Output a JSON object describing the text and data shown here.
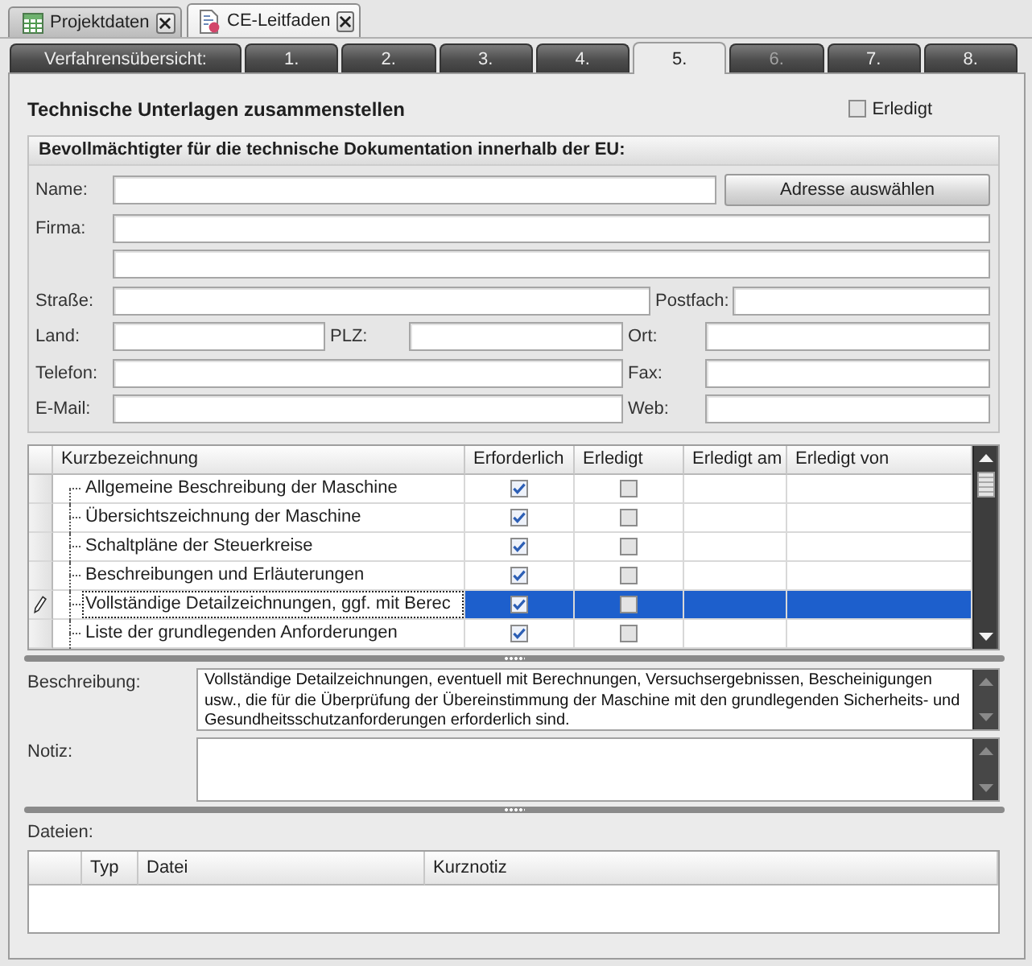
{
  "doc_tabs": [
    {
      "label": "Projektdaten",
      "selected": false
    },
    {
      "label": "CE-Leitfaden",
      "selected": true
    }
  ],
  "step_tabs": [
    {
      "label": "Verfahrensübersicht:",
      "selected": false,
      "disabled": false
    },
    {
      "label": "1.",
      "selected": false,
      "disabled": false
    },
    {
      "label": "2.",
      "selected": false,
      "disabled": false
    },
    {
      "label": "3.",
      "selected": false,
      "disabled": false
    },
    {
      "label": "4.",
      "selected": false,
      "disabled": false
    },
    {
      "label": "5.",
      "selected": true,
      "disabled": false
    },
    {
      "label": "6.",
      "selected": false,
      "disabled": true
    },
    {
      "label": "7.",
      "selected": false,
      "disabled": false
    },
    {
      "label": "8.",
      "selected": false,
      "disabled": false
    }
  ],
  "section": {
    "title": "Technische Unterlagen zusammenstellen",
    "done": {
      "label": "Erledigt",
      "checked": false
    }
  },
  "representative": {
    "title": "Bevollmächtigter für die technische Dokumentation innerhalb der EU:",
    "address_button": "Adresse auswählen",
    "rows": [
      {
        "kind": "name",
        "labels": [
          "Name:"
        ]
      },
      {
        "kind": "full",
        "labels": [
          "Firma:"
        ]
      },
      {
        "kind": "full"
      },
      {
        "kind": "street",
        "labels": [
          "Straße:",
          "Postfach:"
        ]
      },
      {
        "kind": "triple",
        "labels": [
          "Land:",
          "PLZ:",
          "Ort:"
        ]
      },
      {
        "kind": "pair",
        "labels": [
          "Telefon:",
          "Fax:"
        ]
      },
      {
        "kind": "pair",
        "labels": [
          "E-Mail:",
          "Web:"
        ]
      }
    ]
  },
  "requirements": {
    "columns": [
      "Kurzbezeichnung",
      "Erforderlich",
      "Erledigt",
      "Erledigt am",
      "Erledigt von"
    ],
    "rows": [
      {
        "name": "Allgemeine Beschreibung der Maschine",
        "required": true,
        "done": false,
        "selected": false
      },
      {
        "name": "Übersichtszeichnung der Maschine",
        "required": true,
        "done": false,
        "selected": false
      },
      {
        "name": "Schaltpläne der Steuerkreise",
        "required": true,
        "done": false,
        "selected": false
      },
      {
        "name": "Beschreibungen und Erläuterungen",
        "required": true,
        "done": false,
        "selected": false
      },
      {
        "name": "Vollständige Detailzeichnungen, ggf. mit Berec",
        "required": true,
        "done": false,
        "selected": true
      },
      {
        "name": "Liste der grundlegenden Anforderungen",
        "required": true,
        "done": false,
        "selected": false
      }
    ]
  },
  "description": {
    "label": "Beschreibung:",
    "value": "Vollständige Detailzeichnungen, eventuell mit Berechnungen, Versuchsergebnissen, Bescheinigungen usw., die für die Überprüfung der Übereinstimmung der Maschine mit den grundlegenden Sicherheits- und Gesundheitsschutzanforderungen erforderlich sind."
  },
  "note": {
    "label": "Notiz:"
  },
  "files": {
    "label": "Dateien:",
    "columns": [
      "Typ",
      "Datei",
      "Kurznotiz"
    ]
  }
}
